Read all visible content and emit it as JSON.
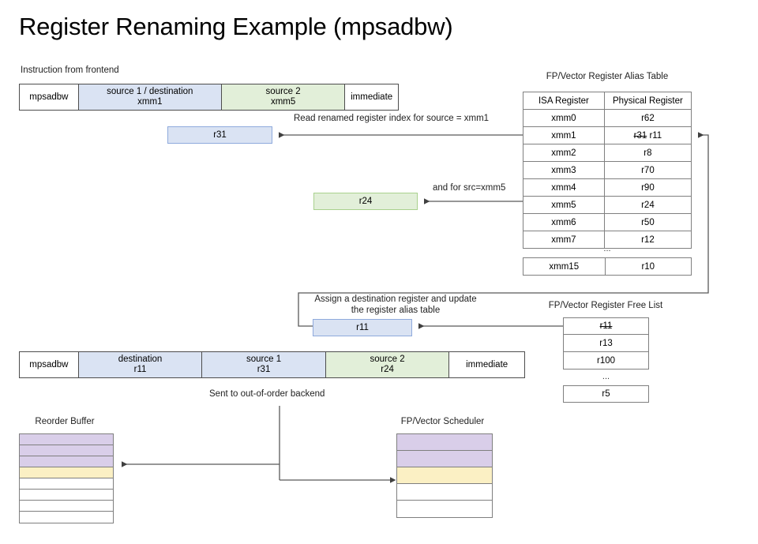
{
  "slide": {
    "title": "Register Renaming Example (mpsadbw)"
  },
  "frontend": {
    "caption": "Instruction from frontend",
    "fields": [
      {
        "name": "opcode",
        "line1": "mpsadbw",
        "line2": "",
        "color": "white"
      },
      {
        "name": "source1dest",
        "line1": "source 1 / destination",
        "line2": "xmm1",
        "color": "blue"
      },
      {
        "name": "source2",
        "line1": "source 2",
        "line2": "xmm5",
        "color": "green"
      },
      {
        "name": "immediate",
        "line1": "immediate",
        "line2": "",
        "color": "white"
      }
    ]
  },
  "renamed_src1": {
    "label": "r31",
    "annotation": "Read renamed register index for source = xmm1"
  },
  "renamed_src2": {
    "label": "r24",
    "annotation": "and for src=xmm5"
  },
  "alias_table": {
    "title": "FP/Vector Register Alias Table",
    "headers": [
      "ISA Register",
      "Physical Register"
    ],
    "rows": [
      {
        "isa": "xmm0",
        "phys": "r62",
        "old": "",
        "new": ""
      },
      {
        "isa": "xmm1",
        "phys": "",
        "old": "r31",
        "new": "r11"
      },
      {
        "isa": "xmm2",
        "phys": "r8",
        "old": "",
        "new": ""
      },
      {
        "isa": "xmm3",
        "phys": "r70",
        "old": "",
        "new": ""
      },
      {
        "isa": "xmm4",
        "phys": "r90",
        "old": "",
        "new": ""
      },
      {
        "isa": "xmm5",
        "phys": "r24",
        "old": "",
        "new": ""
      },
      {
        "isa": "xmm6",
        "phys": "r50",
        "old": "",
        "new": ""
      },
      {
        "isa": "xmm7",
        "phys": "r12",
        "old": "",
        "new": ""
      }
    ],
    "ellipsis": "...",
    "last_row": {
      "isa": "xmm15",
      "phys": "r10"
    }
  },
  "free_list": {
    "title": "FP/Vector Register Free List",
    "entries": [
      {
        "label": "r11",
        "struck": true
      },
      {
        "label": "r13",
        "struck": false
      },
      {
        "label": "r100",
        "struck": false
      }
    ],
    "ellipsis": "...",
    "last_entry": {
      "label": "r5",
      "struck": false
    }
  },
  "dest_assign": {
    "annotation_line1": "Assign a destination register and update",
    "annotation_line2": "the register alias table",
    "label": "r11"
  },
  "renamed_instruction": {
    "fields": [
      {
        "name": "opcode",
        "line1": "mpsadbw",
        "line2": "",
        "color": "white"
      },
      {
        "name": "destination",
        "line1": "destination",
        "line2": "r11",
        "color": "blue"
      },
      {
        "name": "source1",
        "line1": "source 1",
        "line2": "r31",
        "color": "blue"
      },
      {
        "name": "source2",
        "line1": "source 2",
        "line2": "r24",
        "color": "green"
      },
      {
        "name": "immediate",
        "line1": "immediate",
        "line2": "",
        "color": "white"
      }
    ],
    "dispatch_caption": "Sent to out-of-order backend"
  },
  "reorder_buffer": {
    "title": "Reorder Buffer",
    "rows": [
      "purple",
      "purple",
      "purple",
      "yellow",
      "white",
      "white",
      "white",
      "white"
    ]
  },
  "scheduler": {
    "title": "FP/Vector Scheduler",
    "rows": [
      "purple",
      "purple",
      "yellow",
      "white",
      "white"
    ]
  },
  "colors": {
    "blue_fill": "#dae3f3",
    "blue_stroke": "#8faadc",
    "green_fill": "#e2efd9",
    "green_stroke": "#a9d18e",
    "purple_fill": "#d9cee9",
    "yellow_fill": "#fbf0c4",
    "wire": "#595959",
    "border": "#7f7f7f"
  }
}
